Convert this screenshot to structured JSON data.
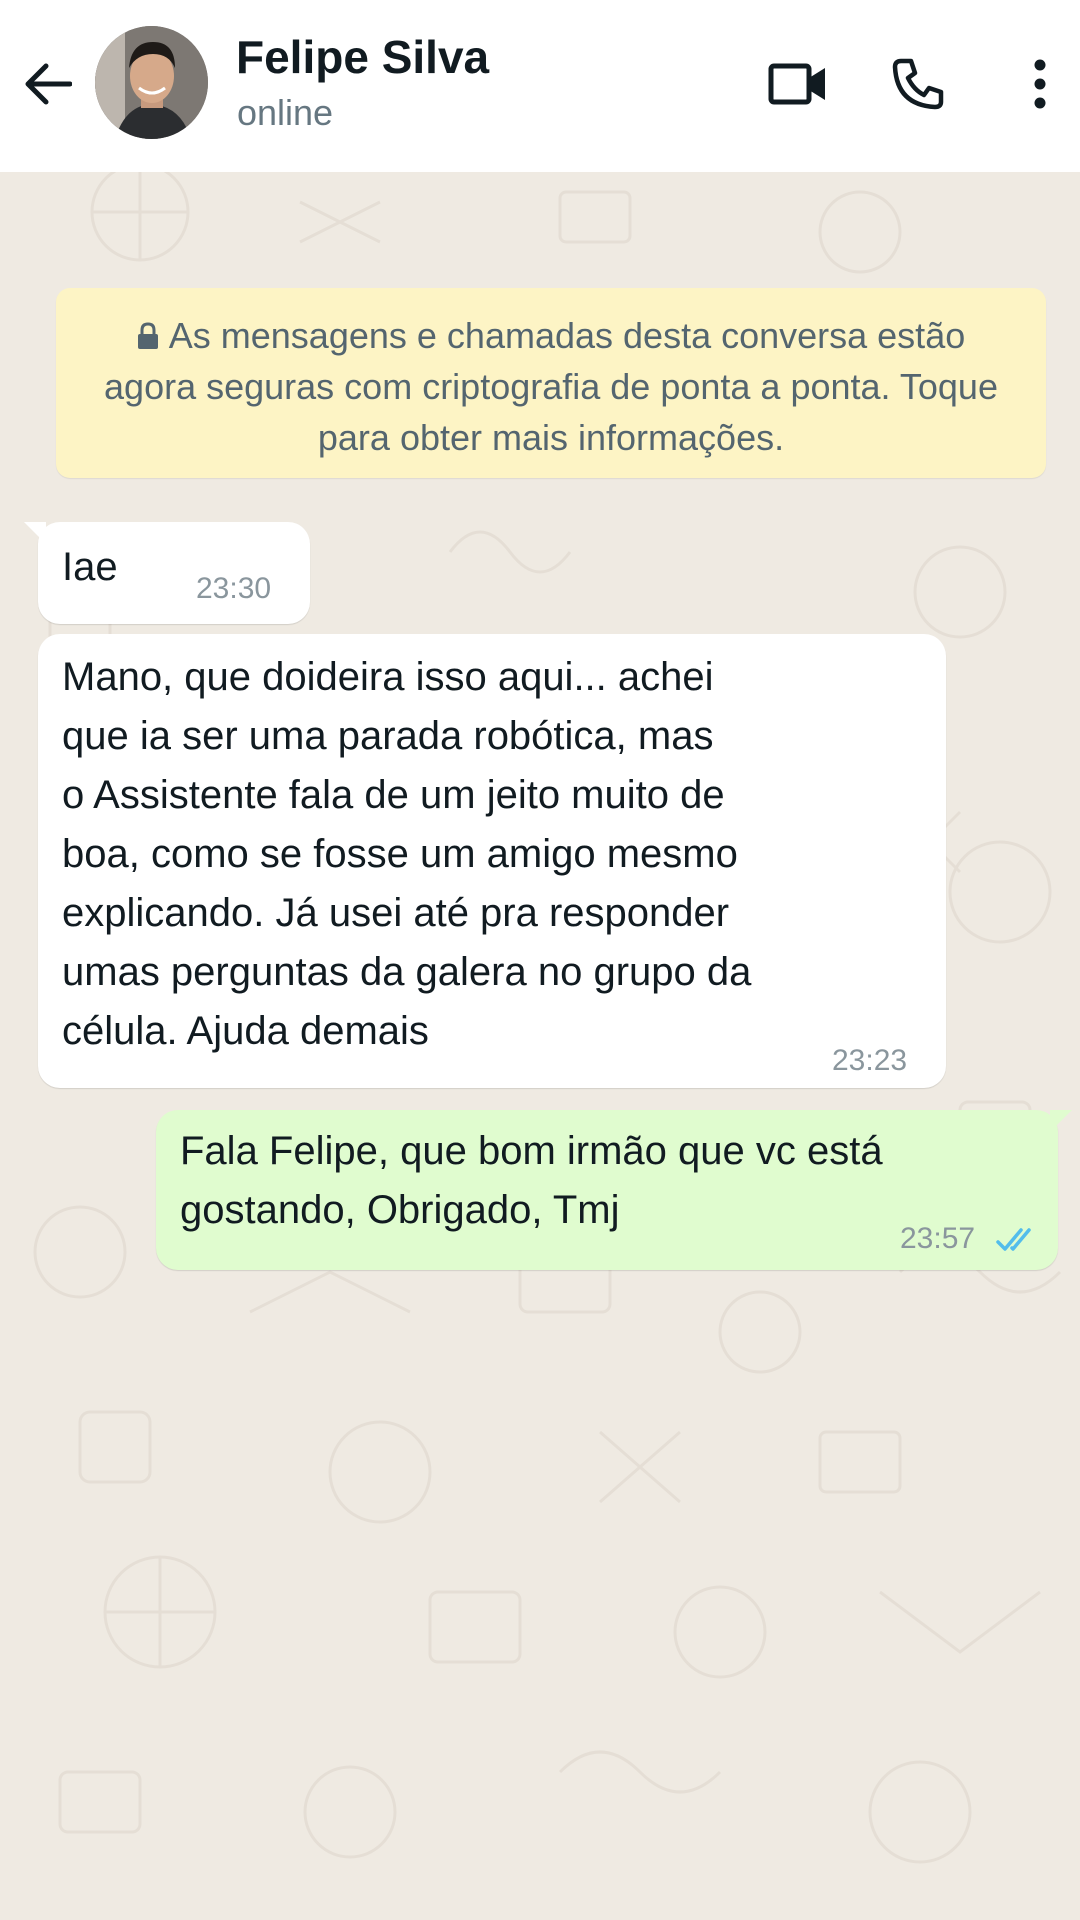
{
  "header": {
    "contact_name": "Felipe Silva",
    "status": "online",
    "icons": {
      "back": "arrow-back-icon",
      "video": "video-call-icon",
      "call": "phone-call-icon",
      "menu": "more-options-icon"
    }
  },
  "chat": {
    "system_notice": "As mensagens e chamadas desta conversa estão agora seguras com criptografia de ponta a ponta. Toque para obter mais informações.",
    "messages": [
      {
        "direction": "incoming",
        "lines": [
          "Iae"
        ],
        "time": "23:30"
      },
      {
        "direction": "incoming",
        "lines": [
          "Mano, que doideira isso aqui... achei",
          "que ia ser uma parada robótica, mas",
          "o Assistente fala de um jeito muito de",
          "boa, como se fosse um amigo mesmo",
          "explicando. Já usei até pra responder",
          "umas perguntas da galera no grupo da",
          "célula. Ajuda demais"
        ],
        "time": "23:23"
      },
      {
        "direction": "outgoing",
        "lines": [
          "Fala Felipe, que bom irmão que vc está",
          "gostando, Obrigado, Tmj"
        ],
        "time": "23:57",
        "status": "read"
      }
    ]
  },
  "colors": {
    "header_bg": "#ffffff",
    "chat_bg": "#efeae2",
    "notice_bg": "#fdf4c5",
    "incoming_bubble": "#ffffff",
    "outgoing_bubble": "#e0fccf",
    "read_ticks": "#53bdeb",
    "timestamp": "#8a969d"
  }
}
